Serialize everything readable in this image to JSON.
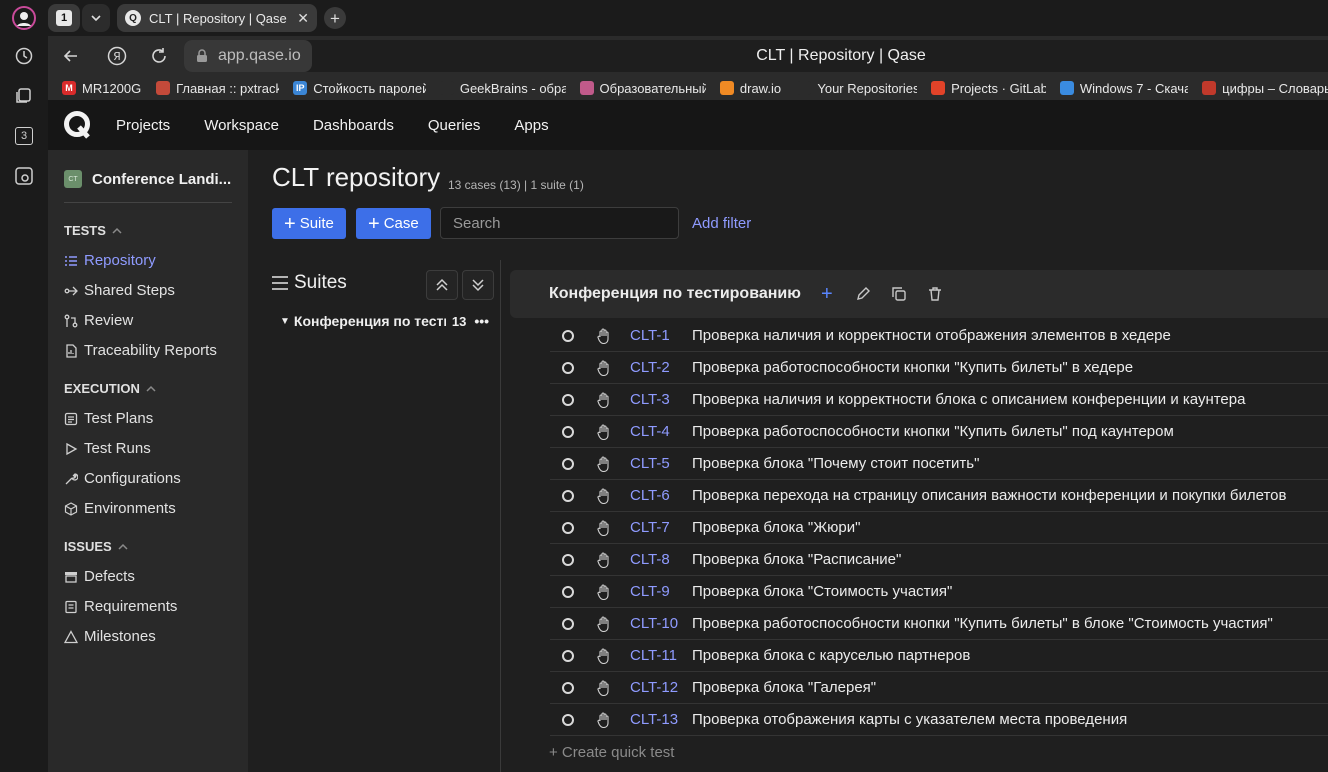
{
  "browser": {
    "tab_count": "1",
    "side_count": "3",
    "active_tab_title": "CLT | Repository | Qase",
    "url": "app.qase.io",
    "page_title": "CLT | Repository | Qase",
    "bookmarks": [
      {
        "label": "MR1200G",
        "icon": "M",
        "color": "#d92b2b"
      },
      {
        "label": "Главная :: pxtrack",
        "icon": "",
        "color": "#c44a3a"
      },
      {
        "label": "Стойкость паролей",
        "icon": "IP",
        "color": "#3b86d6"
      },
      {
        "label": "GeekBrains - обра",
        "icon": "",
        "color": "#2b2b2b"
      },
      {
        "label": "Образовательный",
        "icon": "",
        "color": "#c05a8a"
      },
      {
        "label": "draw.io",
        "icon": "",
        "color": "#f08a24"
      },
      {
        "label": "Your Repositories",
        "icon": "",
        "color": "#2b2b2b"
      },
      {
        "label": "Projects · GitLab",
        "icon": "",
        "color": "#e24329"
      },
      {
        "label": "Windows 7 - Скача",
        "icon": "",
        "color": "#3a8be0"
      },
      {
        "label": "цифры – Словарь",
        "icon": "",
        "color": "#c0392b"
      }
    ]
  },
  "topnav": {
    "items": [
      "Projects",
      "Workspace",
      "Dashboards",
      "Queries",
      "Apps"
    ]
  },
  "sidebar": {
    "project_avatar": "CT",
    "project_name": "Conference Landi...",
    "sections": [
      {
        "title": "TESTS",
        "items": [
          "Repository",
          "Shared Steps",
          "Review",
          "Traceability Reports"
        ]
      },
      {
        "title": "EXECUTION",
        "items": [
          "Test Plans",
          "Test Runs",
          "Configurations",
          "Environments"
        ]
      },
      {
        "title": "ISSUES",
        "items": [
          "Defects",
          "Requirements",
          "Milestones"
        ]
      }
    ]
  },
  "main": {
    "title": "CLT repository",
    "meta": "13 cases (13) | 1 suite (1)",
    "suite_button": "Suite",
    "case_button": "Case",
    "search_placeholder": "Search",
    "add_filter": "Add filter",
    "suites_header": "Suites",
    "suite_tree": {
      "name": "Конференция по тестированию",
      "count": "13"
    },
    "suite_title": "Конференция по тестированию",
    "quick_test": "+ Create quick test",
    "cases": [
      {
        "id": "CLT-1",
        "title": "Проверка наличия и корректности отображения элементов в хедере"
      },
      {
        "id": "CLT-2",
        "title": "Проверка работоспособности кнопки \"Купить билеты\" в хедере"
      },
      {
        "id": "CLT-3",
        "title": "Проверка наличия и корректности блока с описанием конференции и каунтера"
      },
      {
        "id": "CLT-4",
        "title": "Проверка работоспособности кнопки \"Купить билеты\" под каунтером"
      },
      {
        "id": "CLT-5",
        "title": "Проверка блока \"Почему стоит посетить\""
      },
      {
        "id": "CLT-6",
        "title": "Проверка перехода на страницу описания важности конференции и покупки билетов"
      },
      {
        "id": "CLT-7",
        "title": "Проверка блока \"Жюри\""
      },
      {
        "id": "CLT-8",
        "title": "Проверка блока \"Расписание\""
      },
      {
        "id": "CLT-9",
        "title": "Проверка блока \"Стоимость участия\""
      },
      {
        "id": "CLT-10",
        "title": "Проверка работоспособности кнопки \"Купить билеты\" в блоке \"Стоимость участия\""
      },
      {
        "id": "CLT-11",
        "title": "Проверка блока с каруселью партнеров"
      },
      {
        "id": "CLT-12",
        "title": "Проверка блока \"Галерея\""
      },
      {
        "id": "CLT-13",
        "title": "Проверка отображения карты с указателем места проведения"
      }
    ]
  },
  "colors": {
    "accent": "#3d6fe8",
    "link": "#8f9bff"
  }
}
